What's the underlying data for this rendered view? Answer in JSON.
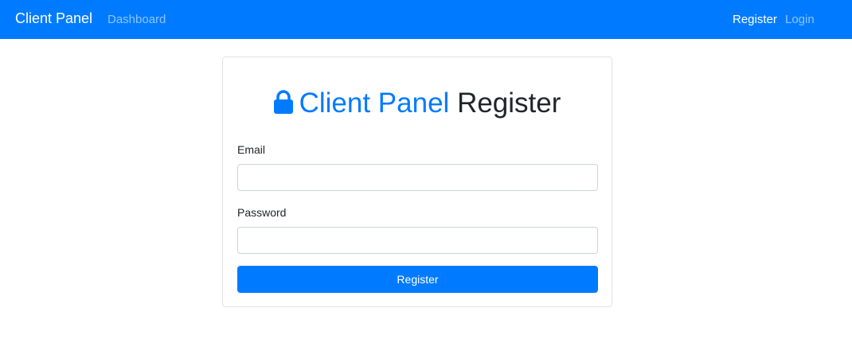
{
  "navbar": {
    "brand": "Client Panel",
    "links_left": [
      "Dashboard"
    ],
    "links_right": [
      "Register",
      "Login"
    ],
    "color": "#007bff"
  },
  "card": {
    "title_accent": "Client Panel",
    "title_rest": "Register",
    "title_icon": "lock-icon",
    "fields": {
      "email": {
        "label": "Email",
        "value": "",
        "placeholder": ""
      },
      "password": {
        "label": "Password",
        "value": "",
        "placeholder": ""
      }
    },
    "submit_label": "Register"
  },
  "colors": {
    "primary": "#007bff",
    "text": "#212529",
    "border": "#ced4da"
  }
}
